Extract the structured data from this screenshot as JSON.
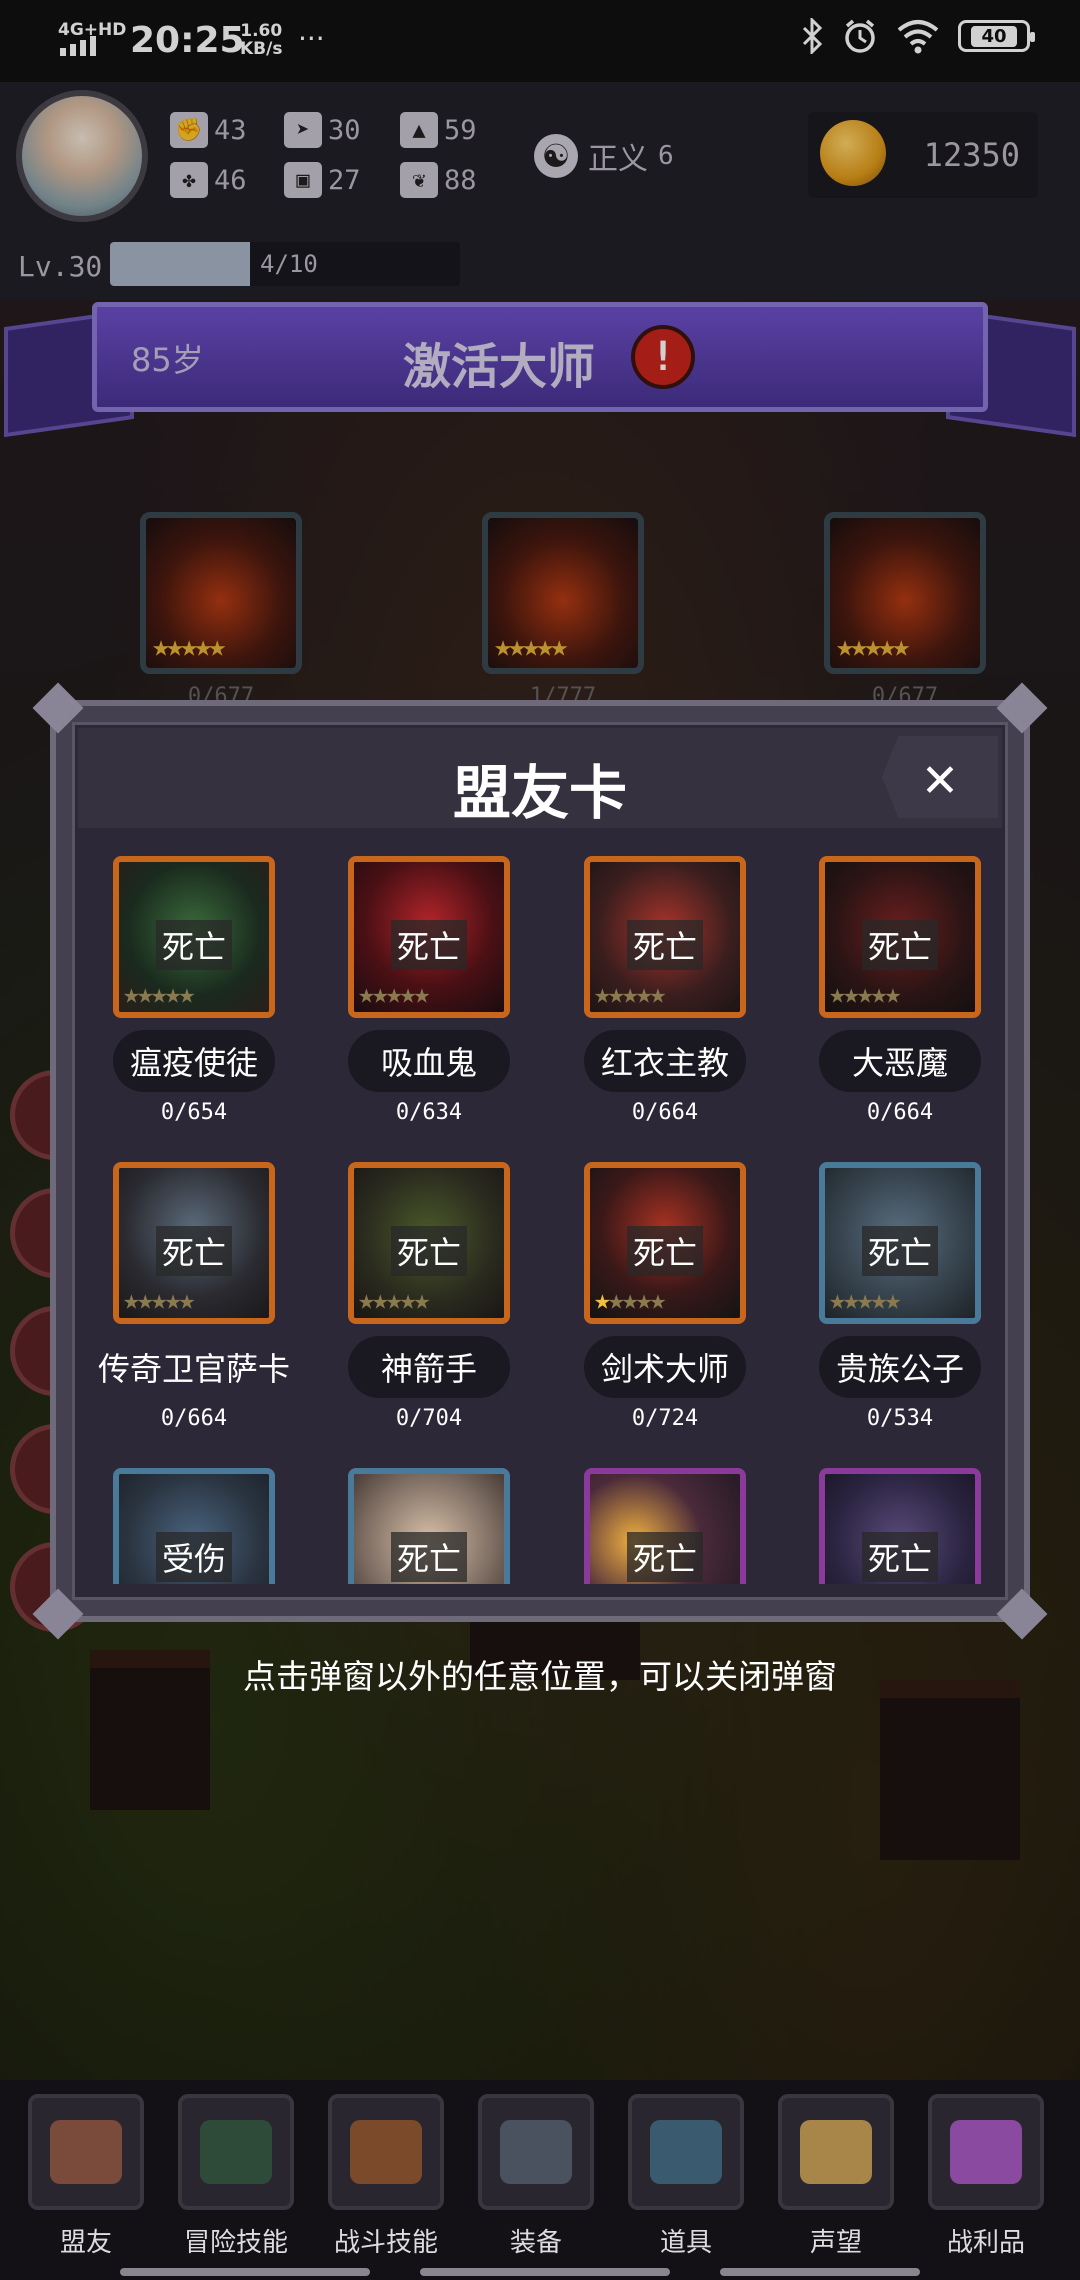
{
  "status_bar": {
    "network": "4G+HD",
    "time": "20:25",
    "speed_value": "1.60",
    "speed_unit": "KB/s",
    "more": "···",
    "battery": "40"
  },
  "header": {
    "stats": [
      {
        "icon": "fist-icon",
        "value": "43"
      },
      {
        "icon": "arrow-icon",
        "value": "30"
      },
      {
        "icon": "wizard-hat-icon",
        "value": "59"
      },
      {
        "icon": "clover-icon",
        "value": "46"
      },
      {
        "icon": "armor-icon",
        "value": "27"
      },
      {
        "icon": "wings-icon",
        "value": "88"
      }
    ],
    "alignment_label": "正义",
    "alignment_value": "6",
    "gold": "12350",
    "level": "Lv.30",
    "xp": "4/10",
    "xp_progress": 0.4
  },
  "banner": {
    "age": "85岁",
    "title": "激活大师",
    "alert": "!"
  },
  "background_cards": {
    "counts": [
      "0/677",
      "1/777",
      "0/677"
    ],
    "stars": "★★★★★"
  },
  "modal": {
    "title": "盟友卡",
    "close": "✕",
    "allies": [
      {
        "name": "瘟疫使徒",
        "status": "死亡",
        "count": "0/654",
        "stars_on": 0,
        "frame": "orange"
      },
      {
        "name": "吸血鬼",
        "status": "死亡",
        "count": "0/634",
        "stars_on": 0,
        "frame": "orange"
      },
      {
        "name": "红衣主教",
        "status": "死亡",
        "count": "0/664",
        "stars_on": 0,
        "frame": "orange"
      },
      {
        "name": "大恶魔",
        "status": "死亡",
        "count": "0/664",
        "stars_on": 0,
        "frame": "orange"
      },
      {
        "name": "传奇卫官萨卡",
        "status": "死亡",
        "count": "0/664",
        "stars_on": 0,
        "frame": "orange"
      },
      {
        "name": "神箭手",
        "status": "死亡",
        "count": "0/704",
        "stars_on": 0,
        "frame": "orange"
      },
      {
        "name": "剑术大师",
        "status": "死亡",
        "count": "0/724",
        "stars_on": 1,
        "frame": "orange"
      },
      {
        "name": "贵族公子",
        "status": "死亡",
        "count": "0/534",
        "stars_on": 0,
        "frame": "blue"
      },
      {
        "name": "",
        "status": "受伤",
        "count": "",
        "stars_on": 0,
        "frame": "blue"
      },
      {
        "name": "",
        "status": "死亡",
        "count": "",
        "stars_on": 0,
        "frame": "blue"
      },
      {
        "name": "",
        "status": "死亡",
        "count": "",
        "stars_on": 0,
        "frame": "purple"
      },
      {
        "name": "",
        "status": "死亡",
        "count": "",
        "stars_on": 0,
        "frame": "purple"
      }
    ]
  },
  "hint": "点击弹窗以外的任意位置，可以关闭弹窗",
  "nav": [
    {
      "label": "盟友",
      "icon": "handshake-icon",
      "color": "#7a4a3a"
    },
    {
      "label": "冒险技能",
      "icon": "spellbook-icon",
      "color": "#2e4a38"
    },
    {
      "label": "战斗技能",
      "icon": "backpack-icon",
      "color": "#7a4a2a"
    },
    {
      "label": "装备",
      "icon": "crossed-swords-shield-icon",
      "color": "#4a5260"
    },
    {
      "label": "道具",
      "icon": "satchel-icon",
      "color": "#3a5a70"
    },
    {
      "label": "声望",
      "icon": "scroll-icon",
      "color": "#a8864a"
    },
    {
      "label": "战利品",
      "icon": "treasure-chest-icon",
      "color": "#8a4aa0"
    }
  ]
}
